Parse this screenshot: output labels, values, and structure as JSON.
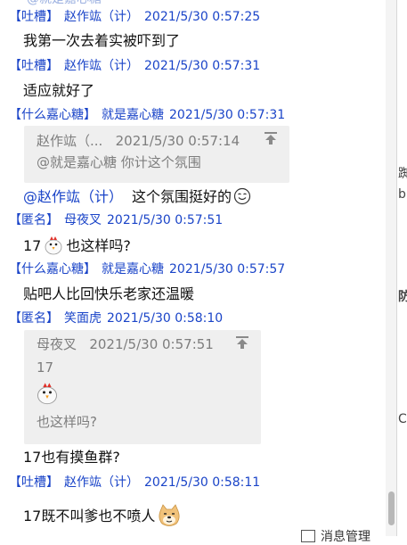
{
  "top_fragment": "@就是嘉心糖",
  "messages": [
    {
      "tag": "【吐槽】",
      "name": "赵作竑（计）",
      "time": "2021/5/30 0:57:25",
      "text": "我第一次去着实被吓到了"
    },
    {
      "tag": "【吐槽】",
      "name": "赵作竑（计）",
      "time": "2021/5/30 0:57:31",
      "text": "适应就好了"
    },
    {
      "tag": "【什么嘉心糖】",
      "name": "就是嘉心糖",
      "time": "2021/5/30 0:57:31",
      "quote": {
        "name": "赵作竑（...",
        "time": "2021/5/30 0:57:14",
        "text": "@就是嘉心糖 你计这个氛围"
      },
      "mention": "@赵作竑（计）",
      "text": "这个氛围挺好的",
      "emoji": "smiling-face-icon"
    },
    {
      "tag": "【匿名】",
      "name": "母夜叉",
      "time": "2021/5/30 0:57:51",
      "text_before": "17",
      "emoji": "chicken-icon",
      "text": "也这样吗?"
    },
    {
      "tag": "【什么嘉心糖】",
      "name": "就是嘉心糖",
      "time": "2021/5/30 0:57:57",
      "text": "贴吧人比回快乐老家还温暖"
    },
    {
      "tag": "【匿名】",
      "name": "笑面虎",
      "time": "2021/5/30 0:58:10",
      "quote": {
        "name": "母夜叉",
        "time": "2021/5/30 0:57:51",
        "line1": "17",
        "emoji": "chicken-icon",
        "line3": "也这样吗?"
      },
      "text": "17也有摸鱼群?"
    },
    {
      "tag": "【吐槽】",
      "name": "赵作竑（计）",
      "time": "2021/5/30 0:58:11",
      "text": "17既不叫爹也不喷人",
      "emoji": "doge-icon"
    }
  ],
  "right_fragments": [
    "踟",
    "b",
    "防",
    "C"
  ],
  "footer": {
    "label": "消息管理"
  },
  "colors": {
    "link": "#1a44c8",
    "quote_bg": "#efefef",
    "quote_text": "#7d7d7d"
  }
}
